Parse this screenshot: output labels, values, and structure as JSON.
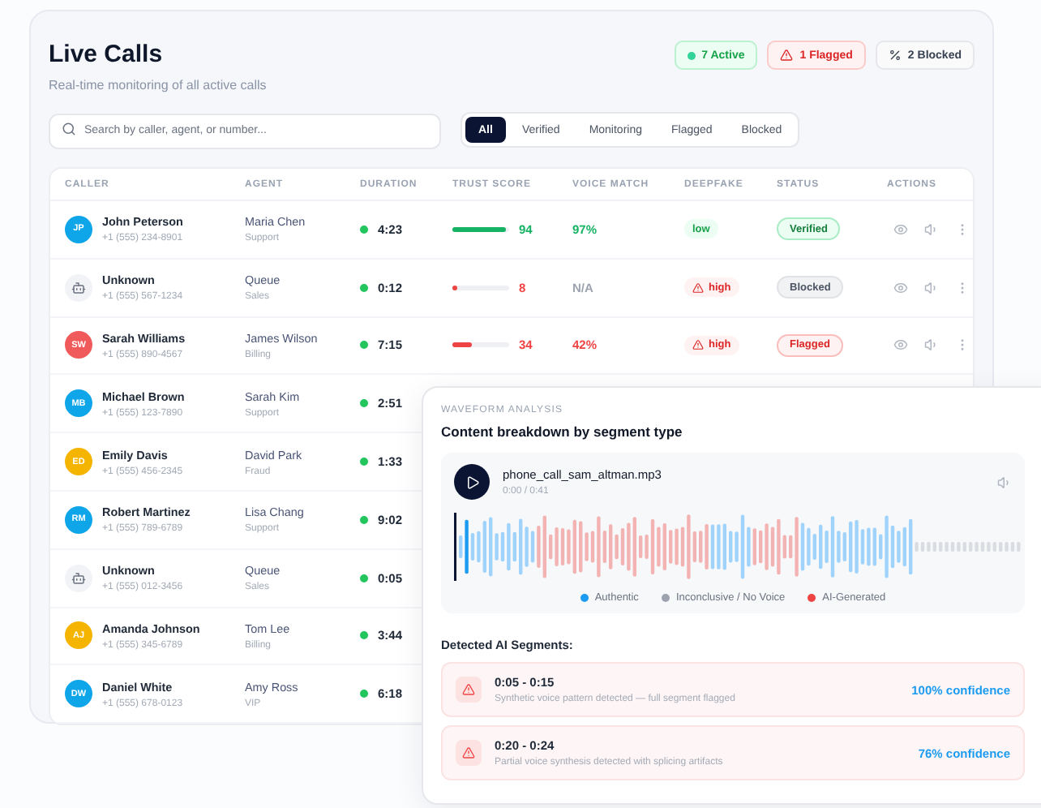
{
  "header": {
    "title": "Live Calls",
    "subtitle": "Real-time monitoring of all active calls"
  },
  "summary": [
    {
      "kind": "active",
      "label": "7 Active"
    },
    {
      "kind": "flagged",
      "label": "1 Flagged"
    },
    {
      "kind": "blocked",
      "label": "2 Blocked"
    }
  ],
  "search": {
    "placeholder": "Search by caller, agent, or number..."
  },
  "filters": [
    {
      "label": "All",
      "selected": true
    },
    {
      "label": "Verified",
      "selected": false
    },
    {
      "label": "Monitoring",
      "selected": false
    },
    {
      "label": "Flagged",
      "selected": false
    },
    {
      "label": "Blocked",
      "selected": false
    }
  ],
  "table": {
    "columns": [
      "CALLER",
      "AGENT",
      "DURATION",
      "TRUST SCORE",
      "VOICE MATCH",
      "DEEPFAKE",
      "STATUS",
      "ACTIONS"
    ],
    "rows": [
      {
        "avatar": {
          "kind": "initials",
          "text": "JP",
          "color": "#0ea5e9"
        },
        "name": "John Peterson",
        "phone": "+1 (555) 234-8901",
        "agent": "Maria Chen",
        "team": "Support",
        "duration": "4:23",
        "trust": {
          "level": 0.94,
          "reading": "94",
          "color": "#16b364"
        },
        "voice": {
          "text": "97%",
          "color": "#16b364"
        },
        "deepfake": {
          "kind": "low",
          "text": "low"
        },
        "status": {
          "kind": "verified",
          "text": "Verified"
        }
      },
      {
        "avatar": {
          "kind": "bot"
        },
        "name": "Unknown",
        "phone": "+1 (555) 567-1234",
        "agent": "Queue",
        "team": "Sales",
        "duration": "0:12",
        "trust": {
          "level": 0.08,
          "reading": "8",
          "color": "#ef4444"
        },
        "voice": {
          "text": "N/A",
          "color": "#9ca3af"
        },
        "deepfake": {
          "kind": "high",
          "text": "high"
        },
        "status": {
          "kind": "blocked",
          "text": "Blocked"
        }
      },
      {
        "avatar": {
          "kind": "initials",
          "text": "SW",
          "color": "#f05a5a"
        },
        "name": "Sarah Williams",
        "phone": "+1 (555) 890-4567",
        "agent": "James Wilson",
        "team": "Billing",
        "duration": "7:15",
        "trust": {
          "level": 0.34,
          "reading": "34",
          "color": "#ef4444"
        },
        "voice": {
          "text": "42%",
          "color": "#ef4444"
        },
        "deepfake": {
          "kind": "high",
          "text": "high"
        },
        "status": {
          "kind": "flagged",
          "text": "Flagged"
        }
      },
      {
        "avatar": {
          "kind": "initials",
          "text": "MB",
          "color": "#0ea5e9"
        },
        "name": "Michael Brown",
        "phone": "+1 (555) 123-7890",
        "agent": "Sarah Kim",
        "team": "Support",
        "duration": "2:51"
      },
      {
        "avatar": {
          "kind": "initials",
          "text": "ED",
          "color": "#f5b400"
        },
        "name": "Emily Davis",
        "phone": "+1 (555) 456-2345",
        "agent": "David Park",
        "team": "Fraud",
        "duration": "1:33"
      },
      {
        "avatar": {
          "kind": "initials",
          "text": "RM",
          "color": "#0ea5e9"
        },
        "name": "Robert Martinez",
        "phone": "+1 (555) 789-6789",
        "agent": "Lisa Chang",
        "team": "Support",
        "duration": "9:02"
      },
      {
        "avatar": {
          "kind": "bot"
        },
        "name": "Unknown",
        "phone": "+1 (555) 012-3456",
        "agent": "Queue",
        "team": "Sales",
        "duration": "0:05"
      },
      {
        "avatar": {
          "kind": "initials",
          "text": "AJ",
          "color": "#f5b400"
        },
        "name": "Amanda Johnson",
        "phone": "+1 (555) 345-6789",
        "agent": "Tom Lee",
        "team": "Billing",
        "duration": "3:44"
      },
      {
        "avatar": {
          "kind": "initials",
          "text": "DW",
          "color": "#0ea5e9"
        },
        "name": "Daniel White",
        "phone": "+1 (555) 678-0123",
        "agent": "Amy Ross",
        "team": "VIP",
        "duration": "6:18"
      }
    ]
  },
  "analysis": {
    "eyebrow": "WAVEFORM ANALYSIS",
    "title": "Content breakdown by segment type",
    "player": {
      "file": "phone_call_sam_altman.mp3",
      "time": "0:00 / 0:41"
    },
    "legend": [
      {
        "label": "Authentic",
        "color": "#1d9bf0"
      },
      {
        "label": "Inconclusive / No Voice",
        "color": "#9ca3af"
      },
      {
        "label": "AI-Generated",
        "color": "#ef4444"
      }
    ],
    "segments_title": "Detected AI Segments:",
    "segments": [
      {
        "range": "0:05 - 0:15",
        "description": "Synthetic voice pattern detected — full segment flagged",
        "confidence": "100% confidence"
      },
      {
        "range": "0:20 - 0:24",
        "description": "Partial voice synthesis detected with splicing artifacts",
        "confidence": "76% confidence"
      }
    ]
  }
}
